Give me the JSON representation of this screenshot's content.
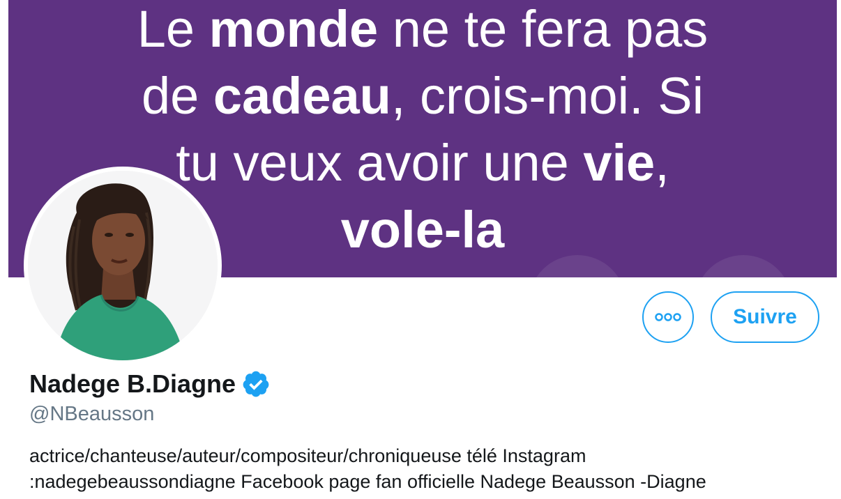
{
  "banner": {
    "quote_lines": [
      [
        {
          "t": "Le ",
          "b": false
        },
        {
          "t": "monde",
          "b": true
        },
        {
          "t": " ne te fera pas",
          "b": false
        }
      ],
      [
        {
          "t": "de ",
          "b": false
        },
        {
          "t": "cadeau",
          "b": true
        },
        {
          "t": ", crois-moi. Si",
          "b": false
        }
      ],
      [
        {
          "t": "tu veux avoir une ",
          "b": false
        },
        {
          "t": "vie",
          "b": true
        },
        {
          "t": ",",
          "b": false
        }
      ],
      [
        {
          "t": "vole-la",
          "b": true
        }
      ]
    ],
    "background_color": "#5e3282"
  },
  "profile": {
    "name": "Nadege B.Diagne",
    "verified": true,
    "handle": "@NBeausson",
    "bio_lines": [
      "actrice/chanteuse/auteur/compositeur/chroniqueuse télé Instagram",
      ":nadegebeaussondiagne Facebook page fan officielle Nadege Beausson -Diagne"
    ]
  },
  "actions": {
    "more_icon": "more-horizontal-icon",
    "follow_label": "Suivre"
  },
  "colors": {
    "accent": "#1da1f2",
    "text": "#14171a",
    "secondary_text": "#657786"
  }
}
